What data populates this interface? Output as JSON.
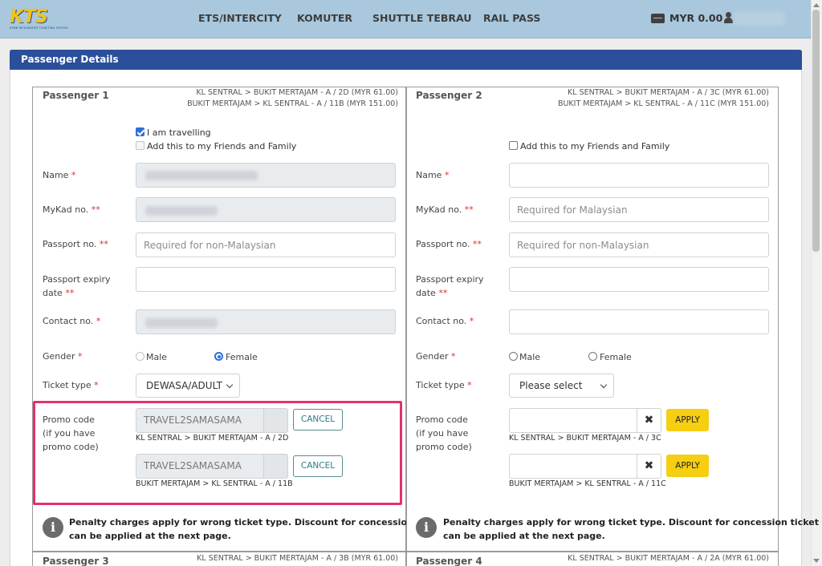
{
  "navbar": {
    "logo_text": "KTS",
    "logo_tagline": "KTMB INTEGRATED TICKETING SYSTEM",
    "links": [
      "ETS/INTERCITY",
      "KOMUTER",
      "SHUTTLE TEBRAU",
      "RAIL PASS"
    ],
    "wallet_balance": "MYR 0.00"
  },
  "section_title": "Passenger Details",
  "passengers": [
    {
      "title": "Passenger 1",
      "routes": [
        "KL SENTRAL > BUKIT MERTAJAM - A / 2D (MYR 61.00)",
        "BUKIT MERTAJAM > KL SENTRAL - A / 11B (MYR 151.00)"
      ],
      "i_am_travelling": "I am travelling",
      "add_friends": "Add this to my Friends and Family",
      "labels": {
        "name": "Name",
        "mykad": "MyKad no.",
        "passport": "Passport no.",
        "passport_expiry_1": "Passport expiry",
        "passport_expiry_2": "date",
        "contact": "Contact no.",
        "gender": "Gender",
        "ticket_type": "Ticket type",
        "promo_1": "Promo code",
        "promo_2": "(if you have",
        "promo_3": "promo code)"
      },
      "passport_placeholder": "Required for non-Malaysian",
      "gender_options": [
        "Male",
        "Female"
      ],
      "ticket_type_value": "DEWASA/ADULT",
      "promo_codes": [
        {
          "code": "TRAVEL2SAMASAMA",
          "button": "CANCEL",
          "note": "KL SENTRAL > BUKIT MERTAJAM - A / 2D"
        },
        {
          "code": "TRAVEL2SAMASAMA",
          "button": "CANCEL",
          "note": "BUKIT MERTAJAM > KL SENTRAL - A / 11B"
        }
      ],
      "info": [
        "Penalty charges apply for wrong ticket type. Discount for concession ticket",
        "can be applied at the next page."
      ]
    },
    {
      "title": "Passenger 2",
      "routes": [
        "KL SENTRAL > BUKIT MERTAJAM - A / 3C (MYR 61.00)",
        "BUKIT MERTAJAM > KL SENTRAL - A / 11C (MYR 151.00)"
      ],
      "add_friends": "Add this to my Friends and Family",
      "labels": {
        "name": "Name",
        "mykad": "MyKad no.",
        "passport": "Passport no.",
        "passport_expiry_1": "Passport expiry",
        "passport_expiry_2": "date",
        "contact": "Contact no.",
        "gender": "Gender",
        "ticket_type": "Ticket type",
        "promo_1": "Promo code",
        "promo_2": "(if you have",
        "promo_3": "promo code)"
      },
      "mykad_placeholder": "Required for Malaysian",
      "passport_placeholder": "Required for non-Malaysian",
      "gender_options": [
        "Male",
        "Female"
      ],
      "ticket_type_value": "Please select",
      "promo_codes": [
        {
          "button": "APPLY",
          "note": "KL SENTRAL > BUKIT MERTAJAM - A / 3C"
        },
        {
          "button": "APPLY",
          "note": "BUKIT MERTAJAM > KL SENTRAL - A / 11C"
        }
      ],
      "info": [
        "Penalty charges apply for wrong ticket type. Discount for concession ticket",
        "can be applied at the next page."
      ]
    },
    {
      "title": "Passenger 3",
      "routes": [
        "KL SENTRAL > BUKIT MERTAJAM - A / 3B (MYR 61.00)"
      ]
    },
    {
      "title": "Passenger 4",
      "routes": [
        "KL SENTRAL > BUKIT MERTAJAM - A / 2A (MYR 61.00)"
      ]
    }
  ],
  "marks": {
    "required_single": "*",
    "required_double": "**",
    "clear": "✖"
  }
}
